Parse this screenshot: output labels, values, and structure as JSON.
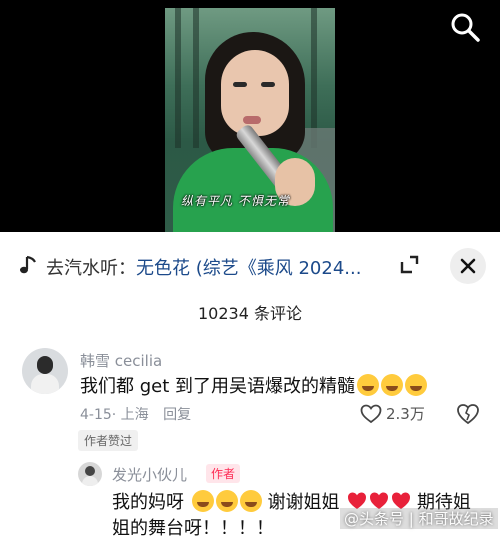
{
  "video": {
    "subtitle": "纵有平凡 不惧无常"
  },
  "music": {
    "prefix": "去汽水听：",
    "title": "无色花 (综艺《乘风 2024..."
  },
  "comments": {
    "count_label": "10234 条评论",
    "first": {
      "username": "韩雪 cecilia",
      "text": "我们都 get 到了用吴语爆改的精髓",
      "date": "4-15",
      "location": "· 上海",
      "reply_label": "回复",
      "likes": "2.3万",
      "badge": "作者赞过"
    },
    "reply": {
      "username": "发光小伙儿",
      "author_tag": "作者",
      "text_part1": "我的妈呀",
      "text_part2": "谢谢姐姐",
      "text_part3": "期待姐姐的舞台呀！！！！"
    }
  },
  "watermark": "@头条号 | 和哥故纪录",
  "colors": {
    "accent": "#fe2c55",
    "music_title": "#1c4a8a"
  },
  "icons": {
    "search": "search-icon",
    "music_note": "music-note-icon",
    "expand": "expand-icon",
    "close": "close-icon",
    "like": "heart-outline-icon",
    "dislike": "broken-heart-icon"
  }
}
